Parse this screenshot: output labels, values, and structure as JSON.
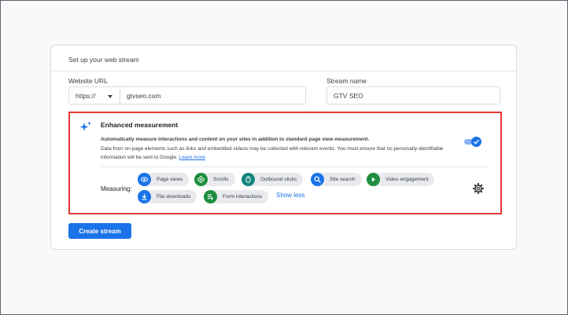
{
  "card": {
    "title": "Set up your web stream"
  },
  "form": {
    "website_url_label": "Website URL",
    "protocol": "https://",
    "url_value": "gtvseo.com",
    "stream_name_label": "Stream name",
    "stream_name_value": "GTV SEO"
  },
  "enhanced": {
    "title": "Enhanced measurement",
    "desc_bold": "Automatically measure interactions and content on your sites in addition to standard page view measurement.",
    "desc": "Data from on-page elements such as links and embedded videos may be collected with relevant events. You must ensure that no personally-identifiable information will be sent to Google.",
    "learn_more": "Learn more",
    "toggle_on": true,
    "measuring_label": "Measuring:",
    "chips": [
      {
        "label": "Page views",
        "icon": "eye-icon",
        "color": "#1a73e8"
      },
      {
        "label": "Scrolls",
        "icon": "crosshair-icon",
        "color": "#1e8e3e"
      },
      {
        "label": "Outbound clicks",
        "icon": "mouse-icon",
        "color": "#12857a"
      },
      {
        "label": "Site search",
        "icon": "search-icon",
        "color": "#1a73e8"
      },
      {
        "label": "Video engagement",
        "icon": "play-icon",
        "color": "#1e8e3e"
      },
      {
        "label": "File downloads",
        "icon": "download-icon",
        "color": "#1a73e8"
      },
      {
        "label": "Form interactions",
        "icon": "form-icon",
        "color": "#1e8e3e"
      }
    ],
    "show_less": "Show less"
  },
  "actions": {
    "create_stream": "Create stream"
  },
  "colors": {
    "accent": "#1a73e8",
    "highlight_border": "#e53935"
  }
}
